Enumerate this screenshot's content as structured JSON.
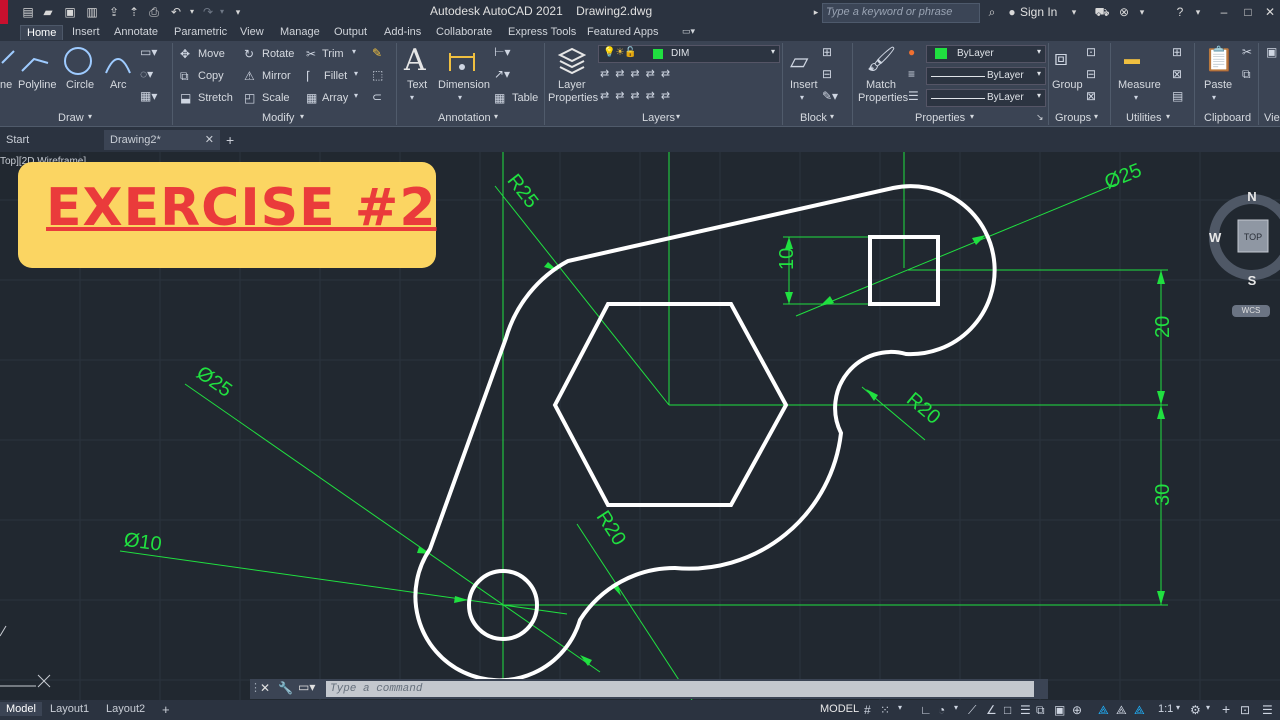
{
  "app": {
    "title": "Autodesk AutoCAD 2021    Drawing2.dwg"
  },
  "search": {
    "placeholder": "Type a keyword or phrase"
  },
  "account": {
    "signin": "Sign In"
  },
  "ribbon_tabs": [
    "Home",
    "Insert",
    "Annotate",
    "Parametric",
    "View",
    "Manage",
    "Output",
    "Add-ins",
    "Collaborate",
    "Express Tools",
    "Featured Apps"
  ],
  "draw": {
    "polyline": "Polyline",
    "circle": "Circle",
    "arc": "Arc",
    "title": "Draw"
  },
  "modify": {
    "move": "Move",
    "rotate": "Rotate",
    "trim": "Trim",
    "copy": "Copy",
    "mirror": "Mirror",
    "fillet": "Fillet",
    "stretch": "Stretch",
    "scale": "Scale",
    "array": "Array",
    "title": "Modify"
  },
  "annotation": {
    "text": "Text",
    "dimension": "Dimension",
    "table": "Table",
    "title": "Annotation"
  },
  "layers": {
    "layer_properties": "Layer\nProperties",
    "layer_name": "DIM",
    "title": "Layers"
  },
  "block": {
    "insert": "Insert",
    "title": "Block"
  },
  "properties": {
    "match": "Match\nProperties",
    "color": "ByLayer",
    "linetype": "ByLayer",
    "lineweight": "ByLayer",
    "title": "Properties"
  },
  "groups": {
    "group": "Group",
    "title": "Groups"
  },
  "utilities": {
    "measure": "Measure",
    "title": "Utilities"
  },
  "clipboard": {
    "paste": "Paste",
    "title": "Clipboard"
  },
  "view_panel": {
    "title": "Vie"
  },
  "file_tabs": {
    "start": "Start",
    "drawing": "Drawing2*"
  },
  "viewport": {
    "label": "Top][2D Wireframe]"
  },
  "exercise": {
    "title": "EXERCISE #2"
  },
  "dimensions": {
    "d_large_circle": "Ø25",
    "r_top_arc": "R25",
    "square": "10",
    "vertical_upper": "20",
    "vertical_lower": "30",
    "r_right_arc": "R20",
    "d_left_circle": "Ø25",
    "d_small_circle": "Ø10",
    "r_bottom_arc": "R20"
  },
  "viewcube": {
    "north": "N",
    "south": "S",
    "west": "W",
    "face": "TOP",
    "wcs": "WCS"
  },
  "command": {
    "placeholder": "Type a command"
  },
  "layout_tabs": [
    "Model",
    "Layout1",
    "Layout2"
  ],
  "status": {
    "mode": "MODEL",
    "scale": "1:1"
  },
  "colors": {
    "accent": "#0f7ae5",
    "dim": "#20e040",
    "geometry": "#ffffff",
    "badge": "#fbd562",
    "badge_text": "#ea3b3b"
  }
}
